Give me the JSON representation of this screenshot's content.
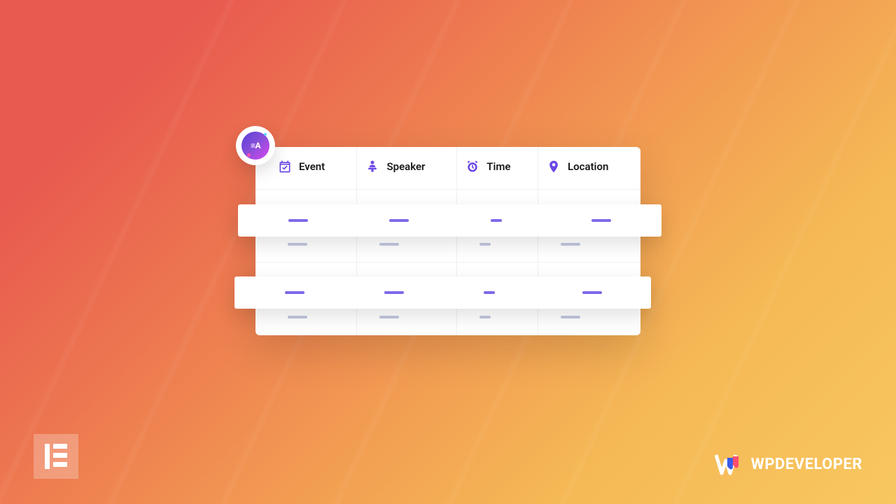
{
  "badge": {
    "label": "≡A"
  },
  "table": {
    "columns": [
      {
        "label": "Event",
        "icon": "calendar-check-icon"
      },
      {
        "label": "Speaker",
        "icon": "speaker-podium-icon"
      },
      {
        "label": "Time",
        "icon": "alarm-clock-icon"
      },
      {
        "label": "Location",
        "icon": "map-pin-icon"
      }
    ],
    "rows": [
      {
        "highlighted": true
      },
      {
        "highlighted": false
      },
      {
        "highlighted": true
      },
      {
        "highlighted": false
      }
    ]
  },
  "branding": {
    "bottom_left": "Elementor",
    "bottom_right_prefix": "WP",
    "bottom_right_suffix": "DEVELOPER"
  },
  "colors": {
    "accent": "#6b46e5",
    "placeholder_dim": "#c2c7e0",
    "placeholder_bright": "#7c6ae8"
  }
}
